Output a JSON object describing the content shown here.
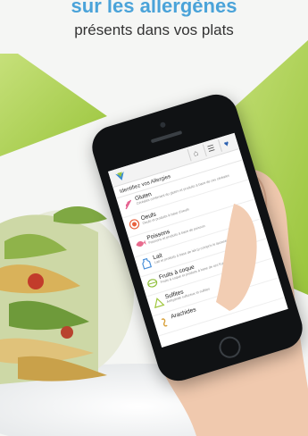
{
  "header": {
    "line1": "sur les allergènes",
    "line2": "présents dans vos plats"
  },
  "colors": {
    "accent_blue": "#4aa3d9",
    "green": "#a8d24a",
    "phone_black": "#101214"
  },
  "app": {
    "toolbar": {
      "home_icon": "home-icon",
      "menu_icon": "menu-icon",
      "heart_icon": "heart-icon"
    },
    "screen_title": "Identifiez vos Allergies",
    "allergens": [
      {
        "name": "Gluten",
        "desc": "Céréales contenant du gluten et produits à base de ces céréales",
        "icon": "wheat-icon",
        "color": "#e45a8a"
      },
      {
        "name": "Oeufs",
        "desc": "Oeufs et produits à base d'oeufs",
        "icon": "egg-icon",
        "color": "#e8603c"
      },
      {
        "name": "Poissons",
        "desc": "Poissons et produits à base de poisson",
        "icon": "fish-icon",
        "color": "#e86b8e"
      },
      {
        "name": "Lait",
        "desc": "Lait et produits à base de lait (y compris le lactose)",
        "icon": "milk-icon",
        "color": "#4a90d9"
      },
      {
        "name": "Fruits à coque",
        "desc": "Fruits à coque et produits à base de ces fruits",
        "icon": "nut-icon",
        "color": "#8fbf3a"
      },
      {
        "name": "Sulfites",
        "desc": "Anhydride sulfureux et sulfites",
        "icon": "sulfite-icon",
        "color": "#9fc63c"
      },
      {
        "name": "Arachides",
        "desc": "",
        "icon": "peanut-icon",
        "color": "#d8a03a"
      }
    ]
  }
}
